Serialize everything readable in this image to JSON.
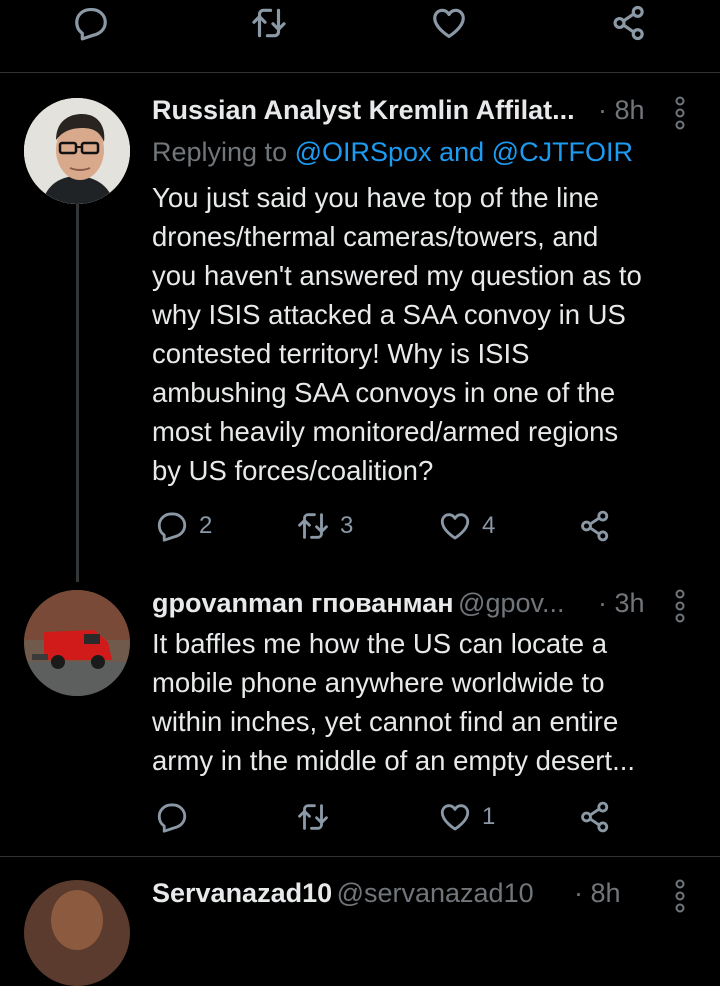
{
  "tweets": [
    {
      "author": "Russian Analyst Kremlin Affilat...",
      "time": "· 8h",
      "replying_prefix": "Replying to",
      "mention_1": "@OIRSpox",
      "mention_and": "and",
      "mention_2": "@CJTFOIR",
      "body": "You just said you have top of the line\ndrones/thermal cameras/towers, and\nyou haven't answered my question as to\nwhy ISIS attacked a SAA convoy in US\ncontested territory! Why is ISIS\nambushing SAA convoys in one of the\nmost heavily monitored/armed regions\nby US forces/coalition?",
      "replies": "2",
      "retweets": "3",
      "likes": "4"
    },
    {
      "author": "gpovanman гпованман",
      "handle": "@gpov...",
      "time": "· 3h",
      "body": "It baffles me how the US can locate a\nmobile phone anywhere worldwide to\nwithin inches, yet cannot find an entire\narmy in the middle of an empty desert...",
      "likes": "1"
    },
    {
      "author": "Servanazad10",
      "handle": "@servanazad10",
      "time": "· 8h"
    }
  ],
  "icons": {
    "reply": "reply-icon",
    "retweet": "retweet-icon",
    "like": "like-icon",
    "share": "share-icon",
    "more": "more-vertical-icon"
  },
  "colors": {
    "background": "#000000",
    "text": "#e7e9ea",
    "muted": "#71767b",
    "link": "#1d9bf0",
    "divider": "#2f3336"
  }
}
